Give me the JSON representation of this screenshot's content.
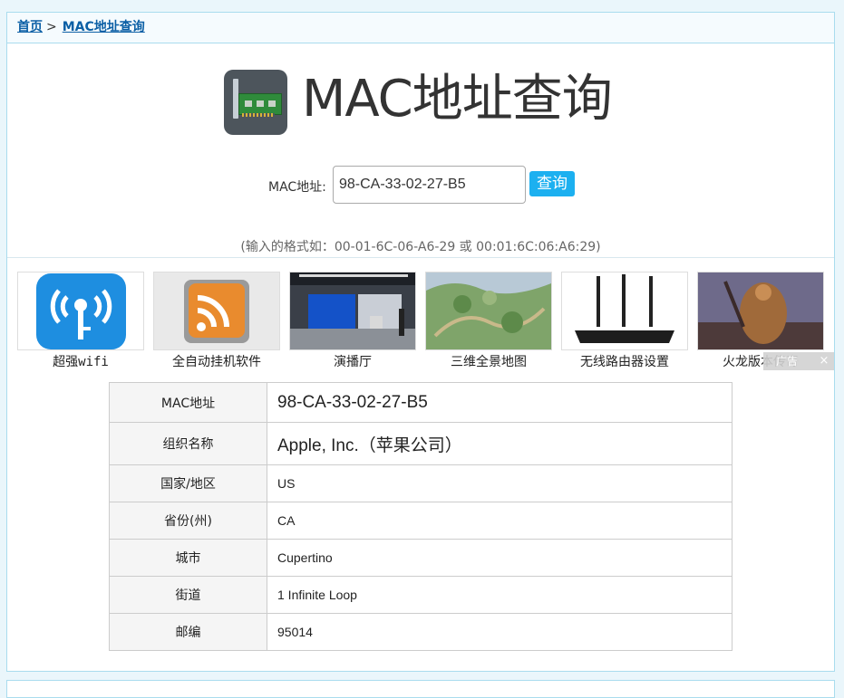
{
  "breadcrumb": {
    "home": "首页",
    "separator": ">",
    "current": "MAC地址查询"
  },
  "header": {
    "title": "MAC地址查询",
    "logo_icon": "network-card-icon"
  },
  "search": {
    "label": "MAC地址:",
    "value": "98-CA-33-02-27-B5",
    "button": "查询",
    "hint": "(输入的格式如：00-01-6C-06-A6-29 或 00:01:6C:06:A6:29)"
  },
  "thumbs": [
    {
      "caption": "超强wifi",
      "icon": "wifi-key-icon"
    },
    {
      "caption": "全自动挂机软件",
      "icon": "rss-icon"
    },
    {
      "caption": "演播厅",
      "icon": "studio-image"
    },
    {
      "caption": "三维全景地图",
      "icon": "terrain-map-image"
    },
    {
      "caption": "无线路由器设置",
      "icon": "router-image"
    },
    {
      "caption": "火龙版本传奇",
      "icon": "warrior-image"
    }
  ],
  "ad": {
    "label": "广告",
    "close": "×"
  },
  "result": [
    {
      "key": "MAC地址",
      "value": "98-CA-33-02-27-B5"
    },
    {
      "key": "组织名称",
      "value": "Apple, Inc.（苹果公司）"
    },
    {
      "key": "国家/地区",
      "value": "US"
    },
    {
      "key": "省份(州)",
      "value": "CA"
    },
    {
      "key": "城市",
      "value": "Cupertino"
    },
    {
      "key": "街道",
      "value": "1 Infinite Loop"
    },
    {
      "key": "邮编",
      "value": "95014"
    }
  ],
  "colors": {
    "accent": "#1cb0f0",
    "link": "#0b5fa5",
    "border": "#a9dcee"
  }
}
